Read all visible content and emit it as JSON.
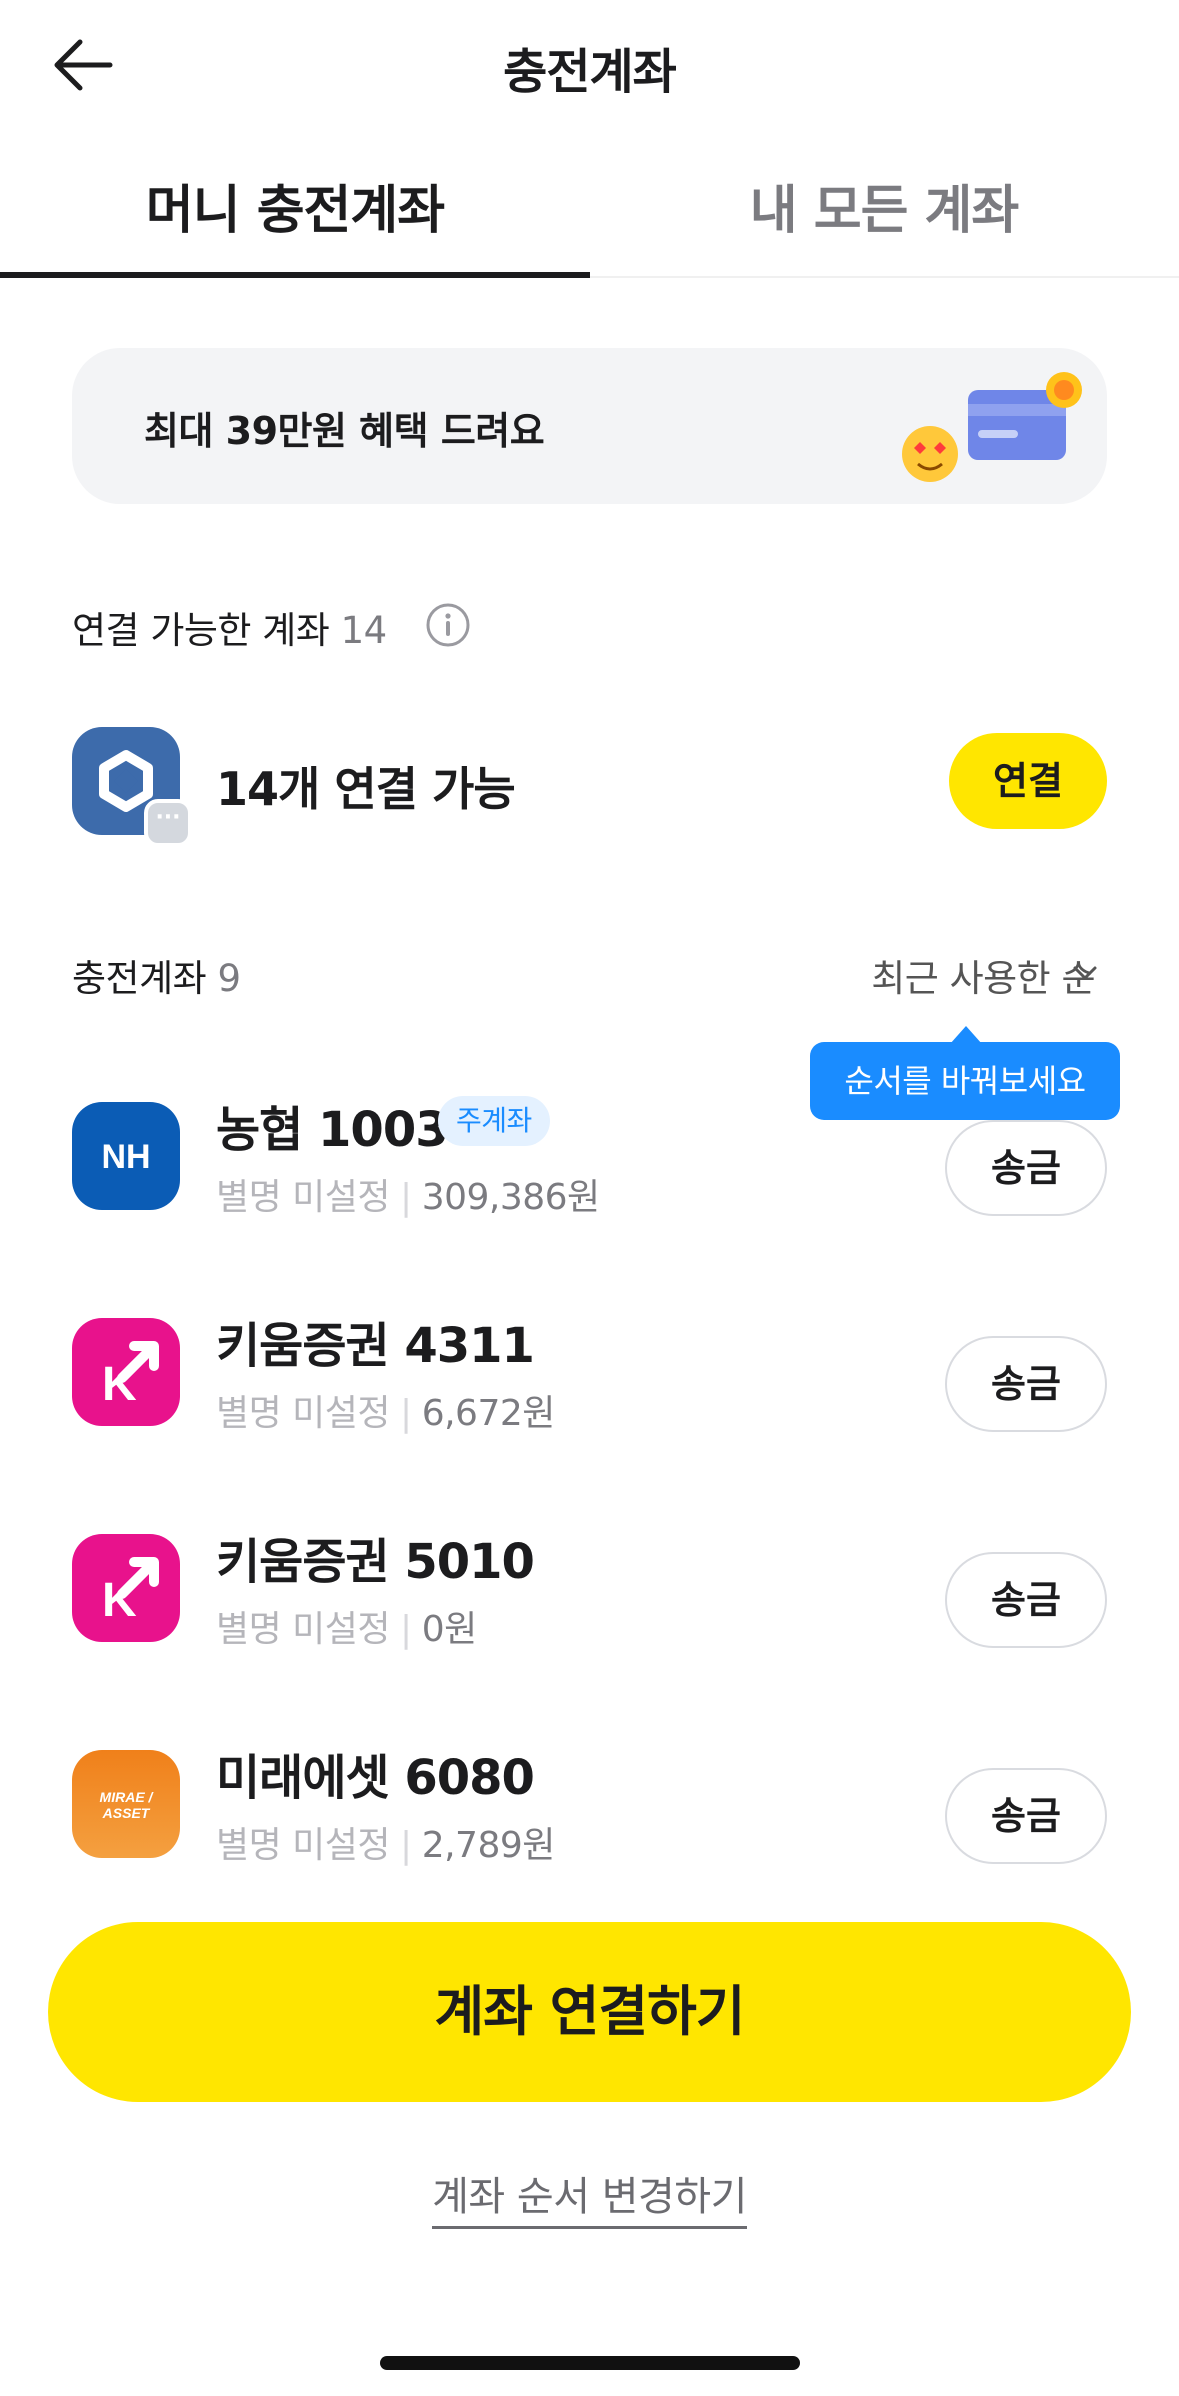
{
  "header": {
    "title": "충전계좌"
  },
  "tabs": [
    {
      "label": "머니 충전계좌"
    },
    {
      "label": "내 모든 계좌"
    }
  ],
  "banner": {
    "text": "최대 39만원 혜택 드려요"
  },
  "connectable": {
    "label": "연결 가능한 계좌",
    "count": "14",
    "summary": "14개 연결 가능",
    "connect_label": "연결"
  },
  "charge_accounts": {
    "label": "충전계좌",
    "count": "9",
    "sort_label": "최근 사용한 순",
    "tooltip": "순서를 바꿔보세요"
  },
  "accounts": [
    {
      "name": "농협 1003",
      "tag": "주계좌",
      "alias": "별명 미설정",
      "balance": "309,386원",
      "button": "송금",
      "logo": "NH",
      "logo_color": "#0b5cb5"
    },
    {
      "name": "키움증권 4311",
      "alias": "별명 미설정",
      "balance": "6,672원",
      "button": "송금",
      "logo": "K",
      "logo_color": "#e8128c"
    },
    {
      "name": "키움증권 5010",
      "alias": "별명 미설정",
      "balance": "0원",
      "button": "송금",
      "logo": "K",
      "logo_color": "#e8128c"
    },
    {
      "name": "미래에셋 6080",
      "alias": "별명 미설정",
      "balance": "2,789원",
      "button": "송금",
      "logo": "MIRAE / ASSET",
      "logo_color": "#f08a1c"
    }
  ],
  "cta": {
    "label": "계좌 연결하기"
  },
  "reorder": {
    "label": "계좌 순서 변경하기"
  },
  "colors": {
    "accent_yellow": "#ffe600",
    "tooltip_blue": "#1a8cff"
  }
}
